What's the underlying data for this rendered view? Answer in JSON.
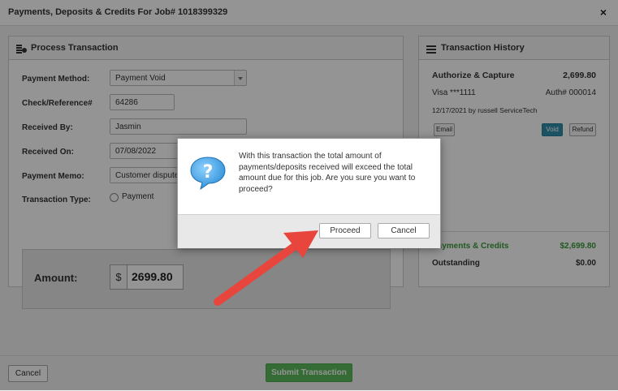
{
  "window": {
    "title": "Payments, Deposits & Credits For Job# 1018399329",
    "close_glyph": "×"
  },
  "process": {
    "title": "Process Transaction",
    "fields": {
      "payment_method": {
        "label": "Payment Method:",
        "value": "Payment Void"
      },
      "check_ref": {
        "label": "Check/Reference#",
        "value": "64286"
      },
      "received_by": {
        "label": "Received By:",
        "value": "Jasmin"
      },
      "received_on": {
        "label": "Received On:",
        "value": "07/08/2022"
      },
      "memo": {
        "label": "Payment Memo:",
        "value": "Customer disputed"
      },
      "transaction_type": {
        "label": "Transaction Type:",
        "option": "Payment"
      }
    },
    "amount": {
      "label": "Amount:",
      "currency": "$",
      "value": "2699.80"
    }
  },
  "history": {
    "title": "Transaction History",
    "entry": {
      "type": "Authorize & Capture",
      "amount": "2,699.80",
      "card": "Visa ***1111",
      "auth": "Auth# 000014",
      "date_by": "12/17/2021 by russell ServiceTech",
      "buttons": {
        "email": "Email",
        "void": "Void",
        "refund": "Refund"
      }
    },
    "summary": {
      "payments_label": "Payments & Credits",
      "payments_value": "$2,699.80",
      "outstanding_label": "Outstanding",
      "outstanding_value": "$0.00"
    }
  },
  "footer": {
    "cancel": "Cancel",
    "submit": "Submit Transaction"
  },
  "dialog": {
    "message": "With this transaction the total amount of payments/deposits received will exceed the total amount due for this job. Are you sure you want to proceed?",
    "proceed": "Proceed",
    "cancel": "Cancel"
  },
  "colors": {
    "accent_green": "#5cb85c",
    "void_blue": "#2f8fae",
    "arrow_red": "#e8453c",
    "question_blue": "#2b8fd6"
  },
  "icons": {
    "process": "coins-icon",
    "history": "list-icon",
    "dialog": "question-bubble-icon",
    "annotation": "red-arrow"
  }
}
